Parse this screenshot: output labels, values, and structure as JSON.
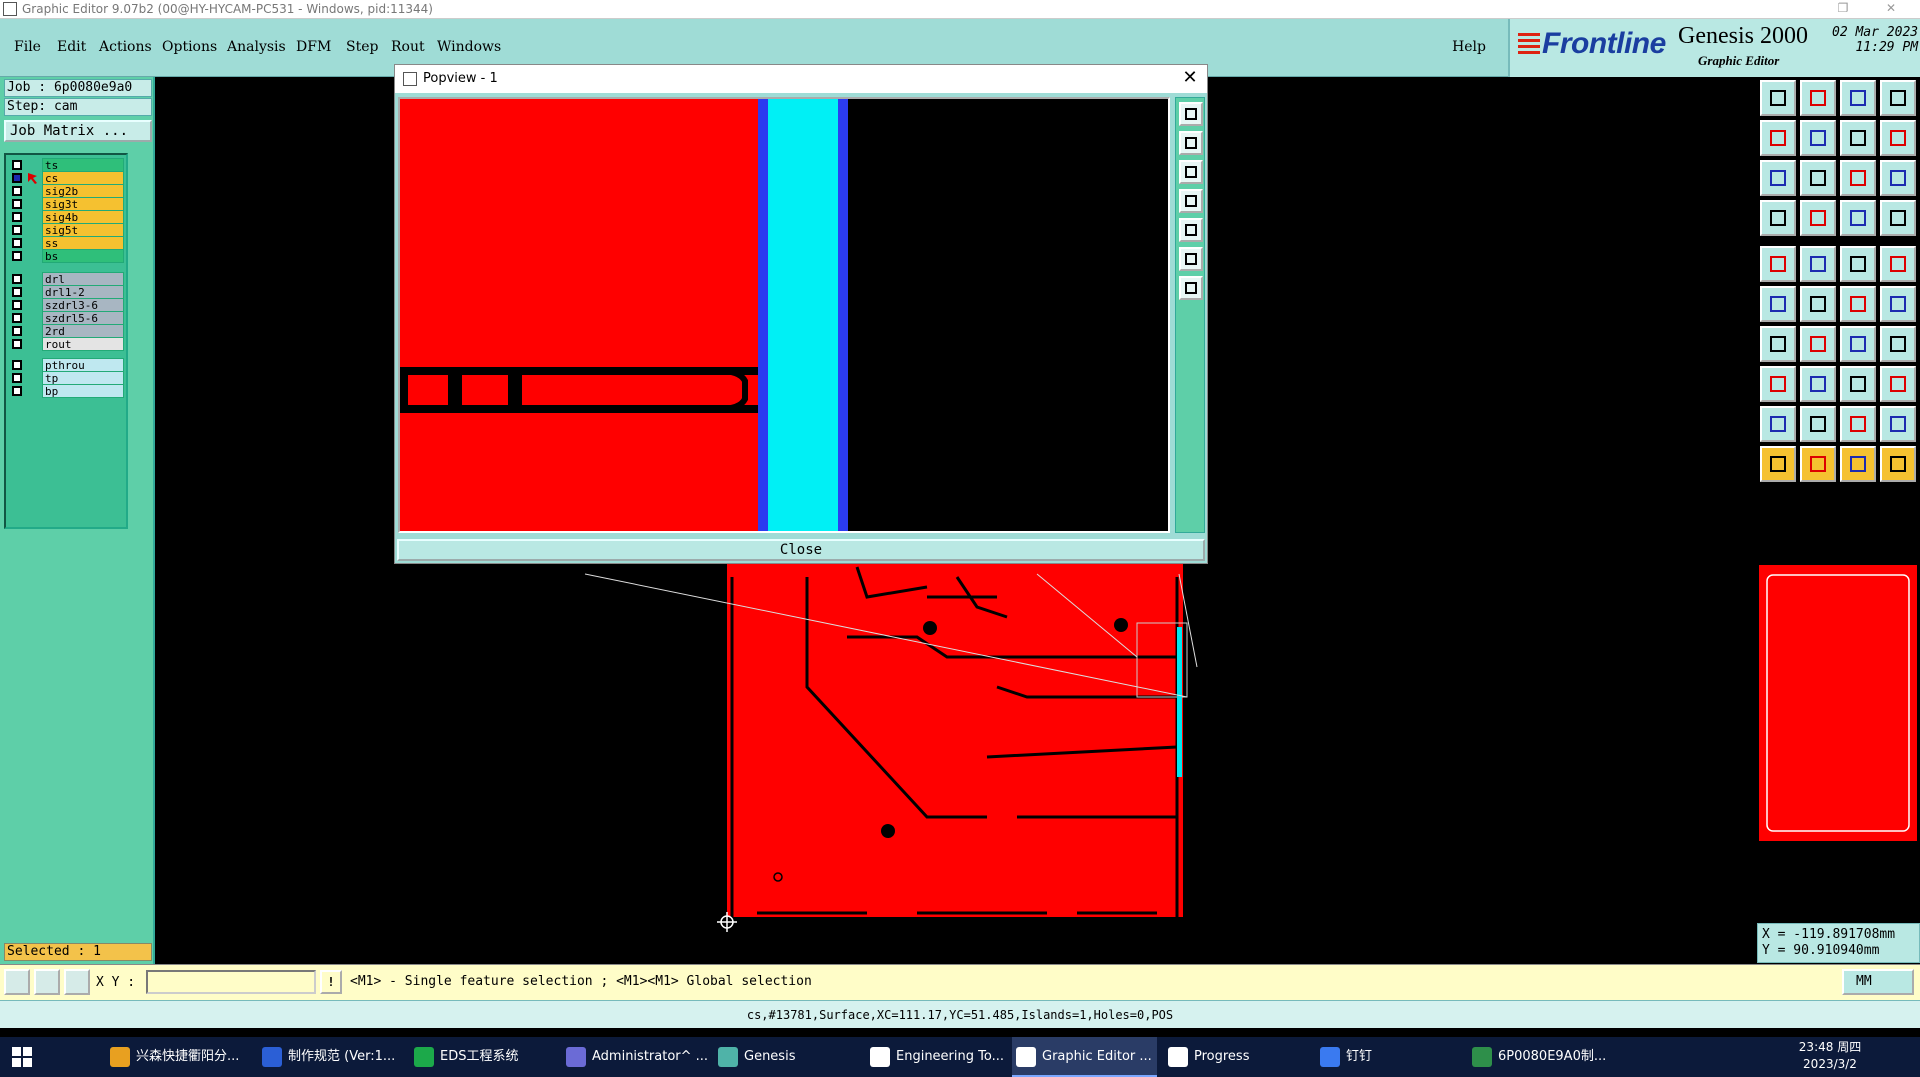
{
  "titlebar": {
    "title": "Graphic Editor 9.07b2 (00@HY-HYCAM-PC531 - Windows, pid:11344)"
  },
  "menu": {
    "items": [
      "File",
      "Edit",
      "Actions",
      "Options",
      "Analysis",
      "DFM",
      "Step",
      "Rout",
      "Windows"
    ],
    "help": "Help"
  },
  "brand": {
    "logo": "Frontline",
    "product": "Genesis 2000",
    "subtitle": "Graphic Editor",
    "date": "02 Mar 2023",
    "time": "11:29 PM"
  },
  "job": {
    "job_label": "Job  : 6p0080e9a0",
    "step_label": "Step: cam",
    "matrix_button": "Job Matrix ..."
  },
  "layers": [
    {
      "name": "ts",
      "color": "#2fbf7a"
    },
    {
      "name": "cs",
      "color": "#f5c130",
      "selected": true
    },
    {
      "name": "sig2b",
      "color": "#f5c130"
    },
    {
      "name": "sig3t",
      "color": "#f5c130"
    },
    {
      "name": "sig4b",
      "color": "#f5c130"
    },
    {
      "name": "sig5t",
      "color": "#f5c130"
    },
    {
      "name": "ss",
      "color": "#f5c130"
    },
    {
      "name": "bs",
      "color": "#2fbf7a"
    },
    {
      "name": "drl",
      "color": "#a8b6c2"
    },
    {
      "name": "drl1-2",
      "color": "#a8b6c2"
    },
    {
      "name": "szdrl3-6",
      "color": "#a8b6c2"
    },
    {
      "name": "szdrl5-6",
      "color": "#a8b6c2"
    },
    {
      "name": "2rd",
      "color": "#a8b6c2"
    },
    {
      "name": "rout",
      "color": "#e4e4e4"
    },
    {
      "name": "pthrou",
      "color": "#bfe8f0"
    },
    {
      "name": "tp",
      "color": "#bfe8f0"
    },
    {
      "name": "bp",
      "color": "#bfe8f0"
    }
  ],
  "selected_label": "Selected : 1",
  "popview": {
    "title": "Popview - 1",
    "close_label": "Close"
  },
  "coords": {
    "x": "X = -119.891708mm",
    "y": "Y =  90.910940mm"
  },
  "command": {
    "xy_label": "X Y :",
    "xy_value": "",
    "excl": "!",
    "hint": "<M1> - Single feature selection ; <M1><M1> Global selection",
    "units": "MM"
  },
  "status": "cs,#13781,Surface,XC=111.17,YC=51.485,Islands=1,Holes=0,POS",
  "taskbar": {
    "tasks": [
      {
        "label": "兴森快捷衢阳分...",
        "color": "#e8a020"
      },
      {
        "label": "制作规范 (Ver:1...",
        "color": "#2b5fd6"
      },
      {
        "label": "EDS工程系统",
        "color": "#1ca94a"
      },
      {
        "label": "Administrator^ ...",
        "color": "#6b6bd6"
      },
      {
        "label": "Genesis",
        "color": "#4fb3a8"
      },
      {
        "label": "Engineering To...",
        "color": "#ffffff"
      },
      {
        "label": "Graphic Editor ...",
        "color": "#ffffff",
        "active": true
      },
      {
        "label": "Progress",
        "color": "#ffffff"
      },
      {
        "label": "钉钉",
        "color": "#3a7af0"
      },
      {
        "label": "6P0080E9A0制...",
        "color": "#2e8f4a"
      }
    ],
    "time": "23:48 周四",
    "date": "2023/3/2"
  }
}
